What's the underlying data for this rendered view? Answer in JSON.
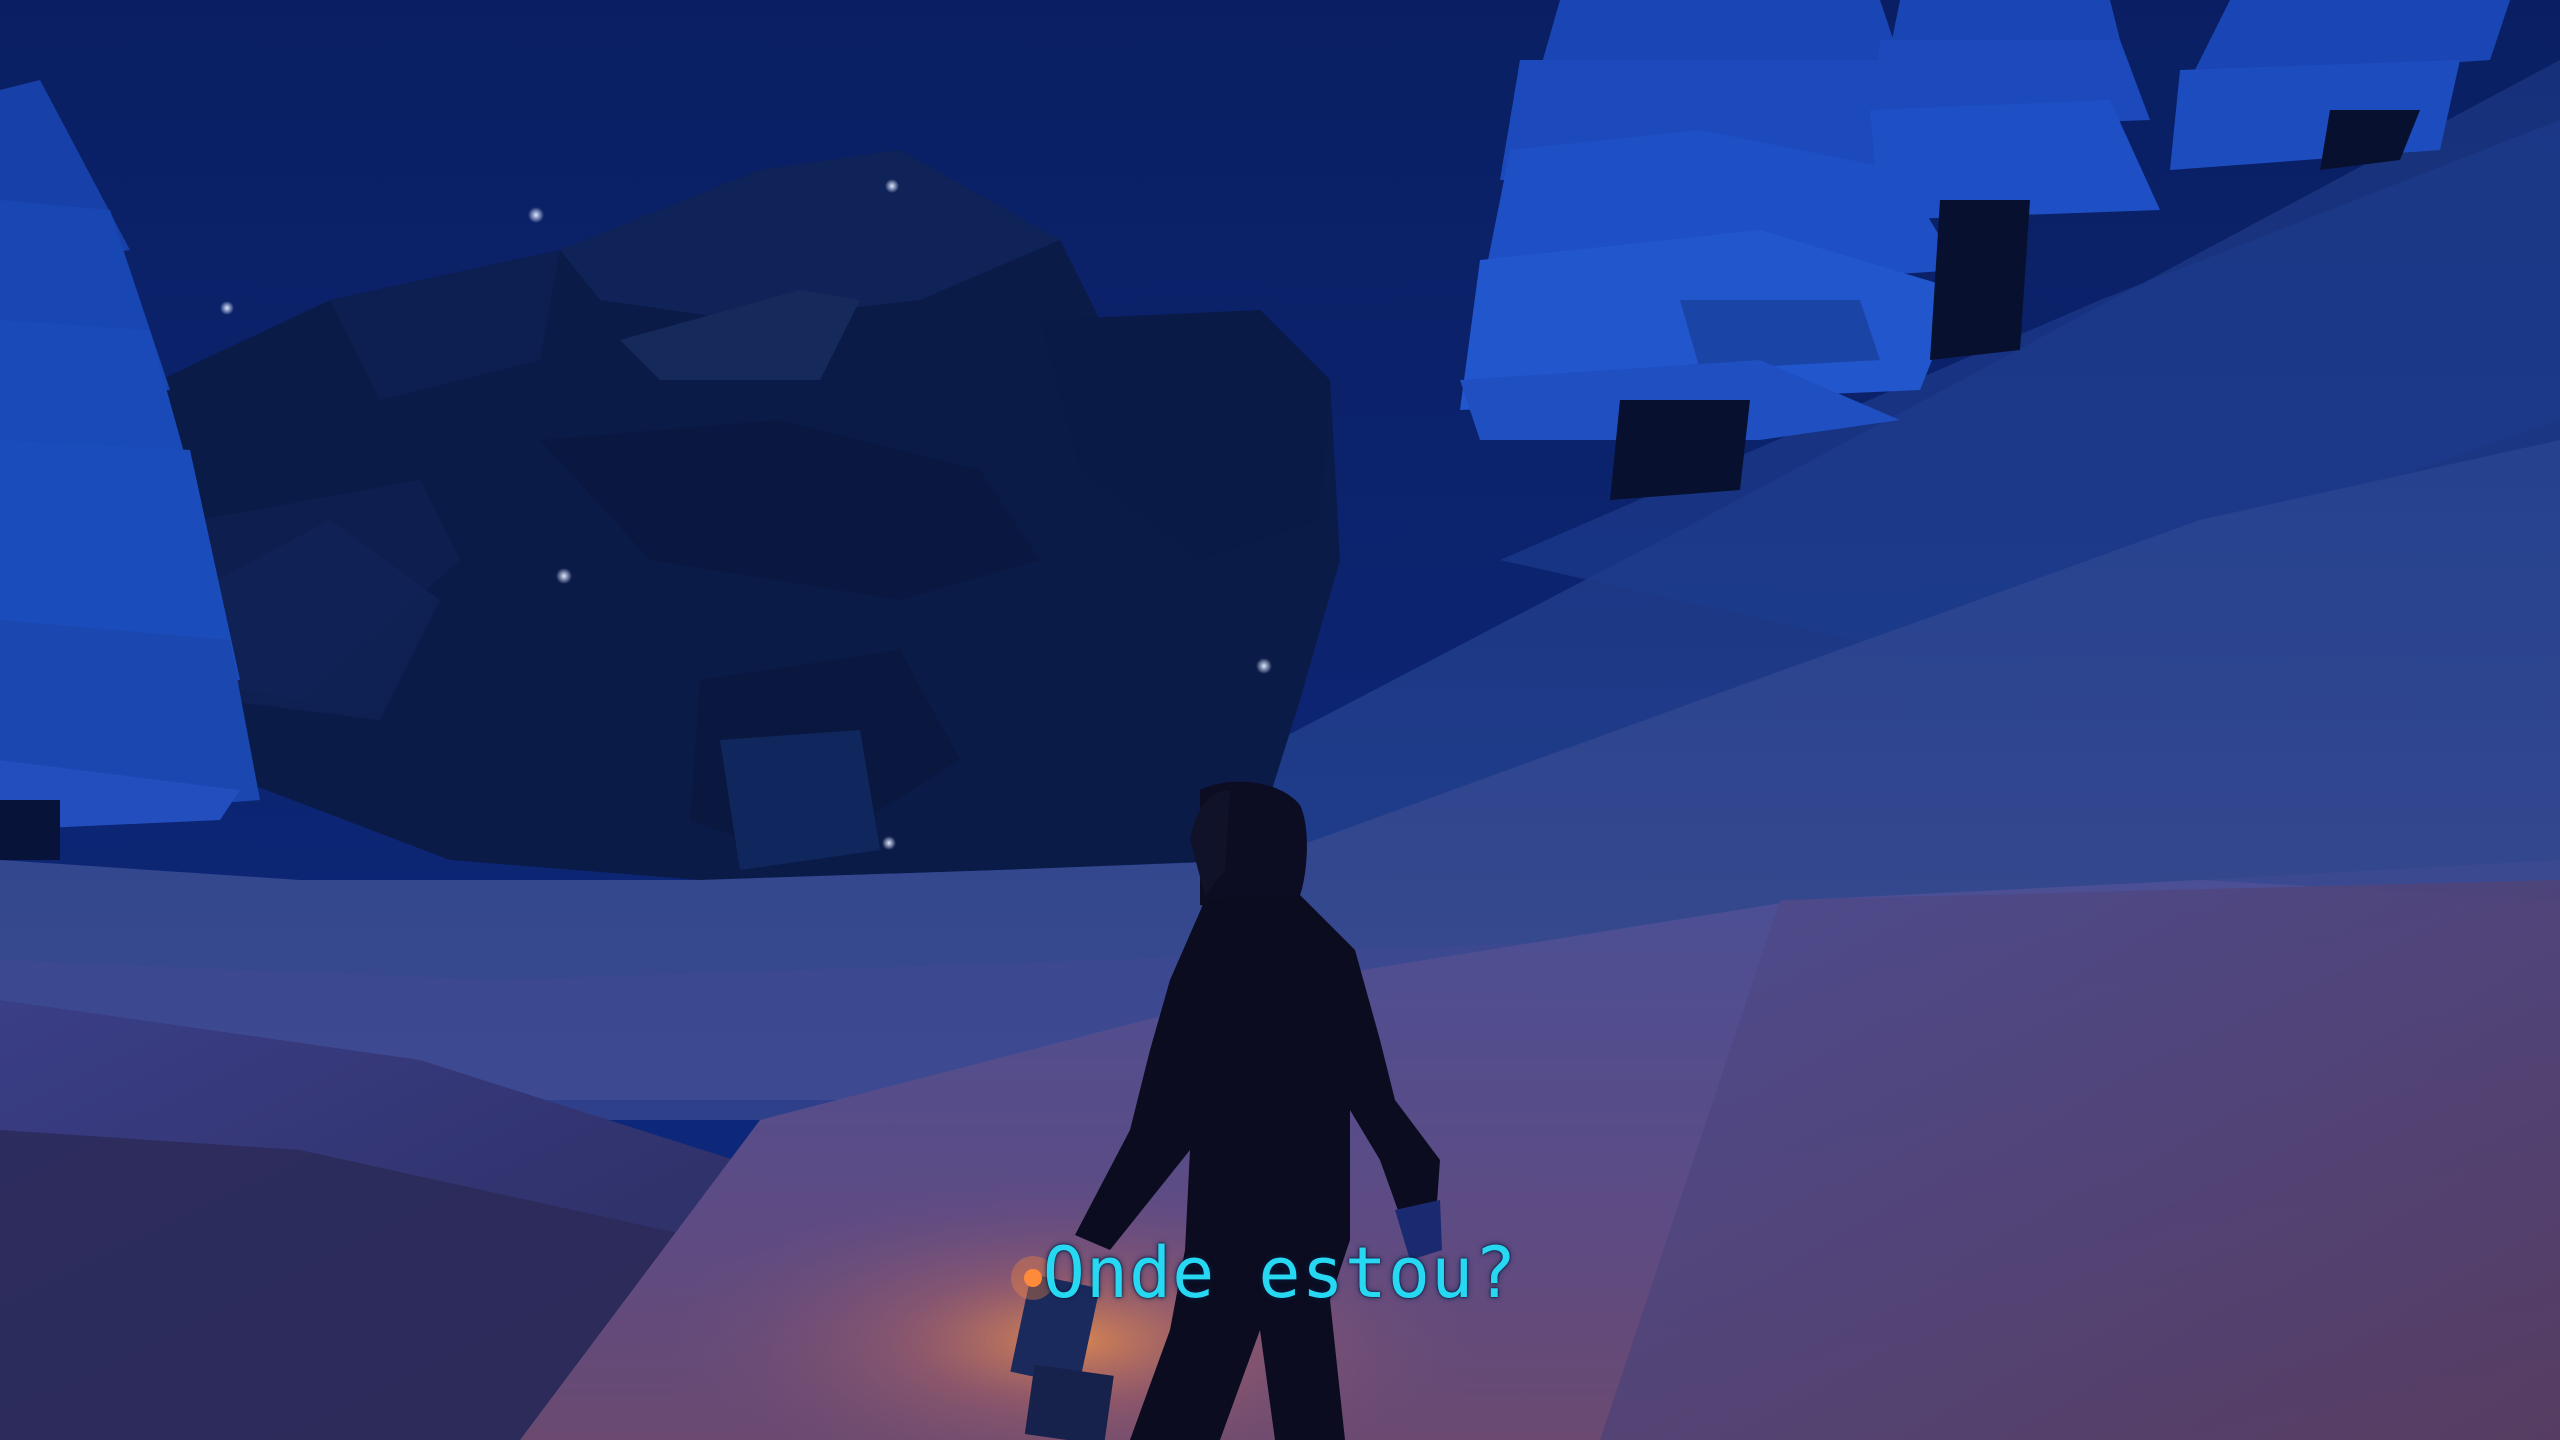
{
  "subtitle": {
    "text": "Onde estou?",
    "color": "#27d8f2"
  },
  "palette": {
    "sky": "#0c2572",
    "rock": "#0b1a46",
    "tree": "#1740a8",
    "snow_far": "#1b3a86",
    "snow_near": "#6a4e7c",
    "lantern_glow": "#ff7a2a"
  }
}
